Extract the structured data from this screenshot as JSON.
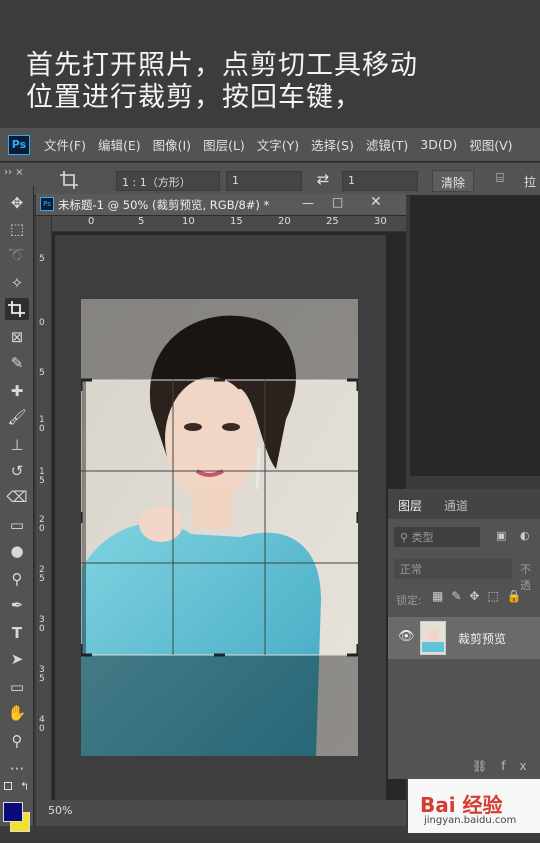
{
  "caption": {
    "line1": "首先打开照片，点剪切工具移动",
    "line2": "位置进行裁剪，按回车键，"
  },
  "app": {
    "logo": "Ps"
  },
  "menu": [
    "文件(F)",
    "编辑(E)",
    "图像(I)",
    "图层(L)",
    "文字(Y)",
    "选择(S)",
    "滤镜(T)",
    "3D(D)",
    "视图(V)"
  ],
  "options": {
    "ratio": "1 : 1（方形）",
    "width": "1",
    "height": "1",
    "clear": "清除",
    "straighten": "拉"
  },
  "document": {
    "tab_title": "未标题-1 @ 50% (裁剪预览, RGB/8#) *",
    "zoom": "50%",
    "ruler_top": [
      "0",
      "5",
      "10",
      "15",
      "20",
      "25",
      "30"
    ],
    "ruler_left": [
      "5",
      "0",
      "5",
      "1 0",
      "1 5",
      "2 0",
      "2 5",
      "3 0",
      "3 5",
      "4 0"
    ]
  },
  "layers_panel": {
    "tabs": [
      "图层",
      "通道"
    ],
    "filter_placeholder": "类型",
    "blend_mode": "正常",
    "opacity_label": "不透",
    "lock_label": "锁定:",
    "layer_name": "裁剪预览"
  },
  "watermark": {
    "brand": "Bai 经验",
    "url": "jingyan.baidu.com"
  },
  "colors": {
    "foreground": "#0a0a78",
    "background": "#f2e12a",
    "ps_accent": "#31a8ff"
  }
}
